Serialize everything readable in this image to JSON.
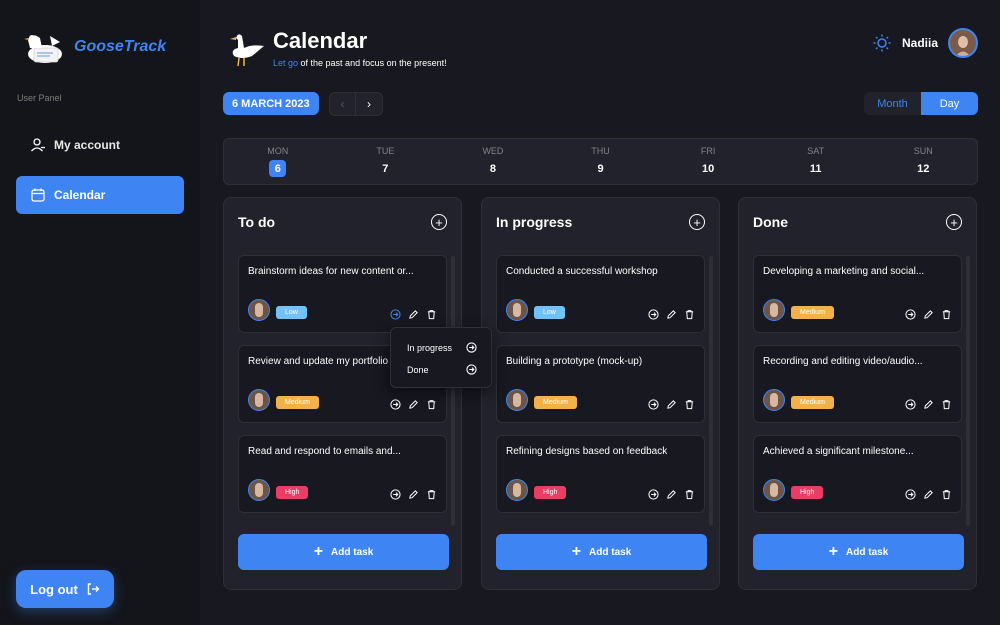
{
  "brand": {
    "name": "GooseTrack"
  },
  "sidebar": {
    "panel_label": "User Panel",
    "items": [
      {
        "label": "My account",
        "icon": "user-icon"
      },
      {
        "label": "Calendar",
        "icon": "calendar-icon"
      }
    ],
    "logout_label": "Log out"
  },
  "header": {
    "title": "Calendar",
    "subtitle_accent": "Let go",
    "subtitle_rest": " of the past and focus on the present!",
    "user_name": "Nadiia"
  },
  "toolbar": {
    "date": "6 MARCH 2023",
    "prev": "‹",
    "next": "›",
    "month_label": "Month",
    "day_label": "Day"
  },
  "week": [
    {
      "day": "MON",
      "num": "6"
    },
    {
      "day": "TUE",
      "num": "7"
    },
    {
      "day": "WED",
      "num": "8"
    },
    {
      "day": "THU",
      "num": "9"
    },
    {
      "day": "FRI",
      "num": "10"
    },
    {
      "day": "SAT",
      "num": "11"
    },
    {
      "day": "SUN",
      "num": "12"
    }
  ],
  "columns": [
    {
      "title": "To do",
      "add_task": "Add task",
      "cards": [
        {
          "title": "Brainstorm ideas for new content or...",
          "priority": "Low"
        },
        {
          "title": "Review and update my portfolio",
          "priority": "Medium"
        },
        {
          "title": "Read and respond to emails and...",
          "priority": "High"
        }
      ]
    },
    {
      "title": "In progress",
      "add_task": "Add task",
      "cards": [
        {
          "title": "Conducted a successful workshop",
          "priority": "Low"
        },
        {
          "title": "Building a prototype (mock-up)",
          "priority": "Medium"
        },
        {
          "title": "Refining designs based on feedback",
          "priority": "High"
        }
      ]
    },
    {
      "title": "Done",
      "add_task": "Add task",
      "cards": [
        {
          "title": "Developing a marketing and social...",
          "priority": "Medium"
        },
        {
          "title": "Recording and editing video/audio...",
          "priority": "Medium"
        },
        {
          "title": "Achieved a significant milestone...",
          "priority": "High"
        }
      ]
    }
  ],
  "popup": {
    "items": [
      "In progress",
      "Done"
    ]
  },
  "colors": {
    "accent": "#3e85f3",
    "low": "#72c2f8",
    "medium": "#f3b249",
    "high": "#ea3d65",
    "background": "#171820",
    "panel": "#21222c"
  }
}
